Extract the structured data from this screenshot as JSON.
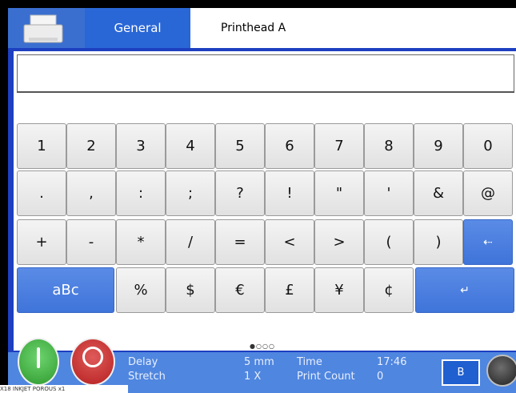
{
  "tabs": {
    "printer_icon": "printer-icon",
    "general_label": "General",
    "printhead_label": "Printhead A"
  },
  "text_entry": {
    "value": ""
  },
  "keyboard": {
    "row1": [
      "1",
      "2",
      "3",
      "4",
      "5",
      "6",
      "7",
      "8",
      "9",
      "0"
    ],
    "row2": [
      ".",
      ",",
      ":",
      ";",
      "?",
      "!",
      "\"",
      "'",
      "&",
      "@"
    ],
    "row3": [
      "+",
      "-",
      "*",
      "/",
      "=",
      "<",
      ">",
      "(",
      ")",
      "⇠"
    ],
    "row4": {
      "shift_label": "aBc",
      "symbols": [
        "%",
        "$",
        "€",
        "£",
        "¥",
        "¢"
      ],
      "enter_label": "↵"
    },
    "pager": "●○○○"
  },
  "status": {
    "delay_label": "Delay",
    "delay_value": "5 mm",
    "stretch_label": "Stretch",
    "stretch_value": "1 X",
    "time_label": "Time",
    "time_value": "17:46",
    "print_count_label": "Print Count",
    "print_count_value": "0",
    "b_button_label": "B",
    "message_name": "X18 INKJET POROUS x1"
  },
  "colors": {
    "accent_blue": "#2a67d6",
    "panel_border": "#1d3fc0",
    "status_bar": "#4f86df",
    "start_green": "#3aa63a",
    "stop_red": "#c62828"
  }
}
